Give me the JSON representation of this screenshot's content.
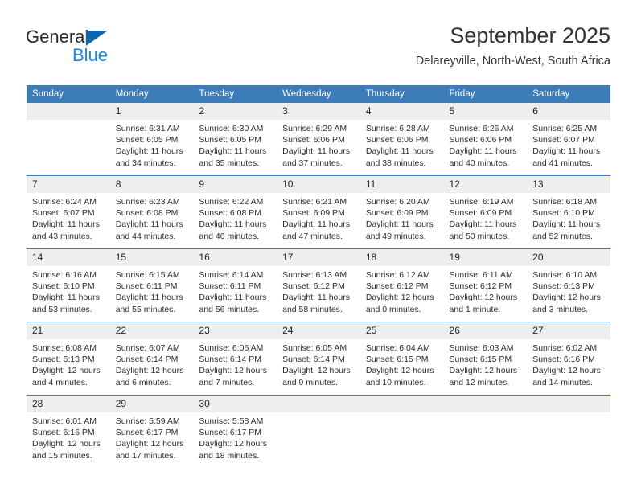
{
  "brand": {
    "name_part1": "General",
    "name_part2": "Blue",
    "logo_icon": "triangle-logo-icon",
    "colors": {
      "triangle": "#1464aa",
      "blue_text": "#1e87df"
    }
  },
  "header": {
    "title": "September 2025",
    "subtitle": "Delareyville, North-West, South Africa"
  },
  "theme": {
    "header_bg": "#3c7cb9",
    "daynum_bg": "#eeeeee",
    "divider": "#3c7cb9"
  },
  "weekday_headers": [
    "Sunday",
    "Monday",
    "Tuesday",
    "Wednesday",
    "Thursday",
    "Friday",
    "Saturday"
  ],
  "weeks": [
    [
      {
        "day": "",
        "empty": true,
        "sunrise": "",
        "sunset": "",
        "daylight_line1": "",
        "daylight_line2": ""
      },
      {
        "day": "1",
        "sunrise": "Sunrise: 6:31 AM",
        "sunset": "Sunset: 6:05 PM",
        "daylight_line1": "Daylight: 11 hours",
        "daylight_line2": "and 34 minutes."
      },
      {
        "day": "2",
        "sunrise": "Sunrise: 6:30 AM",
        "sunset": "Sunset: 6:05 PM",
        "daylight_line1": "Daylight: 11 hours",
        "daylight_line2": "and 35 minutes."
      },
      {
        "day": "3",
        "sunrise": "Sunrise: 6:29 AM",
        "sunset": "Sunset: 6:06 PM",
        "daylight_line1": "Daylight: 11 hours",
        "daylight_line2": "and 37 minutes."
      },
      {
        "day": "4",
        "sunrise": "Sunrise: 6:28 AM",
        "sunset": "Sunset: 6:06 PM",
        "daylight_line1": "Daylight: 11 hours",
        "daylight_line2": "and 38 minutes."
      },
      {
        "day": "5",
        "sunrise": "Sunrise: 6:26 AM",
        "sunset": "Sunset: 6:06 PM",
        "daylight_line1": "Daylight: 11 hours",
        "daylight_line2": "and 40 minutes."
      },
      {
        "day": "6",
        "sunrise": "Sunrise: 6:25 AM",
        "sunset": "Sunset: 6:07 PM",
        "daylight_line1": "Daylight: 11 hours",
        "daylight_line2": "and 41 minutes."
      }
    ],
    [
      {
        "day": "7",
        "sunrise": "Sunrise: 6:24 AM",
        "sunset": "Sunset: 6:07 PM",
        "daylight_line1": "Daylight: 11 hours",
        "daylight_line2": "and 43 minutes."
      },
      {
        "day": "8",
        "sunrise": "Sunrise: 6:23 AM",
        "sunset": "Sunset: 6:08 PM",
        "daylight_line1": "Daylight: 11 hours",
        "daylight_line2": "and 44 minutes."
      },
      {
        "day": "9",
        "sunrise": "Sunrise: 6:22 AM",
        "sunset": "Sunset: 6:08 PM",
        "daylight_line1": "Daylight: 11 hours",
        "daylight_line2": "and 46 minutes."
      },
      {
        "day": "10",
        "sunrise": "Sunrise: 6:21 AM",
        "sunset": "Sunset: 6:09 PM",
        "daylight_line1": "Daylight: 11 hours",
        "daylight_line2": "and 47 minutes."
      },
      {
        "day": "11",
        "sunrise": "Sunrise: 6:20 AM",
        "sunset": "Sunset: 6:09 PM",
        "daylight_line1": "Daylight: 11 hours",
        "daylight_line2": "and 49 minutes."
      },
      {
        "day": "12",
        "sunrise": "Sunrise: 6:19 AM",
        "sunset": "Sunset: 6:09 PM",
        "daylight_line1": "Daylight: 11 hours",
        "daylight_line2": "and 50 minutes."
      },
      {
        "day": "13",
        "sunrise": "Sunrise: 6:18 AM",
        "sunset": "Sunset: 6:10 PM",
        "daylight_line1": "Daylight: 11 hours",
        "daylight_line2": "and 52 minutes."
      }
    ],
    [
      {
        "day": "14",
        "sunrise": "Sunrise: 6:16 AM",
        "sunset": "Sunset: 6:10 PM",
        "daylight_line1": "Daylight: 11 hours",
        "daylight_line2": "and 53 minutes."
      },
      {
        "day": "15",
        "sunrise": "Sunrise: 6:15 AM",
        "sunset": "Sunset: 6:11 PM",
        "daylight_line1": "Daylight: 11 hours",
        "daylight_line2": "and 55 minutes."
      },
      {
        "day": "16",
        "sunrise": "Sunrise: 6:14 AM",
        "sunset": "Sunset: 6:11 PM",
        "daylight_line1": "Daylight: 11 hours",
        "daylight_line2": "and 56 minutes."
      },
      {
        "day": "17",
        "sunrise": "Sunrise: 6:13 AM",
        "sunset": "Sunset: 6:12 PM",
        "daylight_line1": "Daylight: 11 hours",
        "daylight_line2": "and 58 minutes."
      },
      {
        "day": "18",
        "sunrise": "Sunrise: 6:12 AM",
        "sunset": "Sunset: 6:12 PM",
        "daylight_line1": "Daylight: 12 hours",
        "daylight_line2": "and 0 minutes."
      },
      {
        "day": "19",
        "sunrise": "Sunrise: 6:11 AM",
        "sunset": "Sunset: 6:12 PM",
        "daylight_line1": "Daylight: 12 hours",
        "daylight_line2": "and 1 minute."
      },
      {
        "day": "20",
        "sunrise": "Sunrise: 6:10 AM",
        "sunset": "Sunset: 6:13 PM",
        "daylight_line1": "Daylight: 12 hours",
        "daylight_line2": "and 3 minutes."
      }
    ],
    [
      {
        "day": "21",
        "sunrise": "Sunrise: 6:08 AM",
        "sunset": "Sunset: 6:13 PM",
        "daylight_line1": "Daylight: 12 hours",
        "daylight_line2": "and 4 minutes."
      },
      {
        "day": "22",
        "sunrise": "Sunrise: 6:07 AM",
        "sunset": "Sunset: 6:14 PM",
        "daylight_line1": "Daylight: 12 hours",
        "daylight_line2": "and 6 minutes."
      },
      {
        "day": "23",
        "sunrise": "Sunrise: 6:06 AM",
        "sunset": "Sunset: 6:14 PM",
        "daylight_line1": "Daylight: 12 hours",
        "daylight_line2": "and 7 minutes."
      },
      {
        "day": "24",
        "sunrise": "Sunrise: 6:05 AM",
        "sunset": "Sunset: 6:14 PM",
        "daylight_line1": "Daylight: 12 hours",
        "daylight_line2": "and 9 minutes."
      },
      {
        "day": "25",
        "sunrise": "Sunrise: 6:04 AM",
        "sunset": "Sunset: 6:15 PM",
        "daylight_line1": "Daylight: 12 hours",
        "daylight_line2": "and 10 minutes."
      },
      {
        "day": "26",
        "sunrise": "Sunrise: 6:03 AM",
        "sunset": "Sunset: 6:15 PM",
        "daylight_line1": "Daylight: 12 hours",
        "daylight_line2": "and 12 minutes."
      },
      {
        "day": "27",
        "sunrise": "Sunrise: 6:02 AM",
        "sunset": "Sunset: 6:16 PM",
        "daylight_line1": "Daylight: 12 hours",
        "daylight_line2": "and 14 minutes."
      }
    ],
    [
      {
        "day": "28",
        "sunrise": "Sunrise: 6:01 AM",
        "sunset": "Sunset: 6:16 PM",
        "daylight_line1": "Daylight: 12 hours",
        "daylight_line2": "and 15 minutes."
      },
      {
        "day": "29",
        "sunrise": "Sunrise: 5:59 AM",
        "sunset": "Sunset: 6:17 PM",
        "daylight_line1": "Daylight: 12 hours",
        "daylight_line2": "and 17 minutes."
      },
      {
        "day": "30",
        "sunrise": "Sunrise: 5:58 AM",
        "sunset": "Sunset: 6:17 PM",
        "daylight_line1": "Daylight: 12 hours",
        "daylight_line2": "and 18 minutes."
      },
      {
        "day": "",
        "empty": true,
        "sunrise": "",
        "sunset": "",
        "daylight_line1": "",
        "daylight_line2": ""
      },
      {
        "day": "",
        "empty": true,
        "sunrise": "",
        "sunset": "",
        "daylight_line1": "",
        "daylight_line2": ""
      },
      {
        "day": "",
        "empty": true,
        "sunrise": "",
        "sunset": "",
        "daylight_line1": "",
        "daylight_line2": ""
      },
      {
        "day": "",
        "empty": true,
        "sunrise": "",
        "sunset": "",
        "daylight_line1": "",
        "daylight_line2": ""
      }
    ]
  ]
}
